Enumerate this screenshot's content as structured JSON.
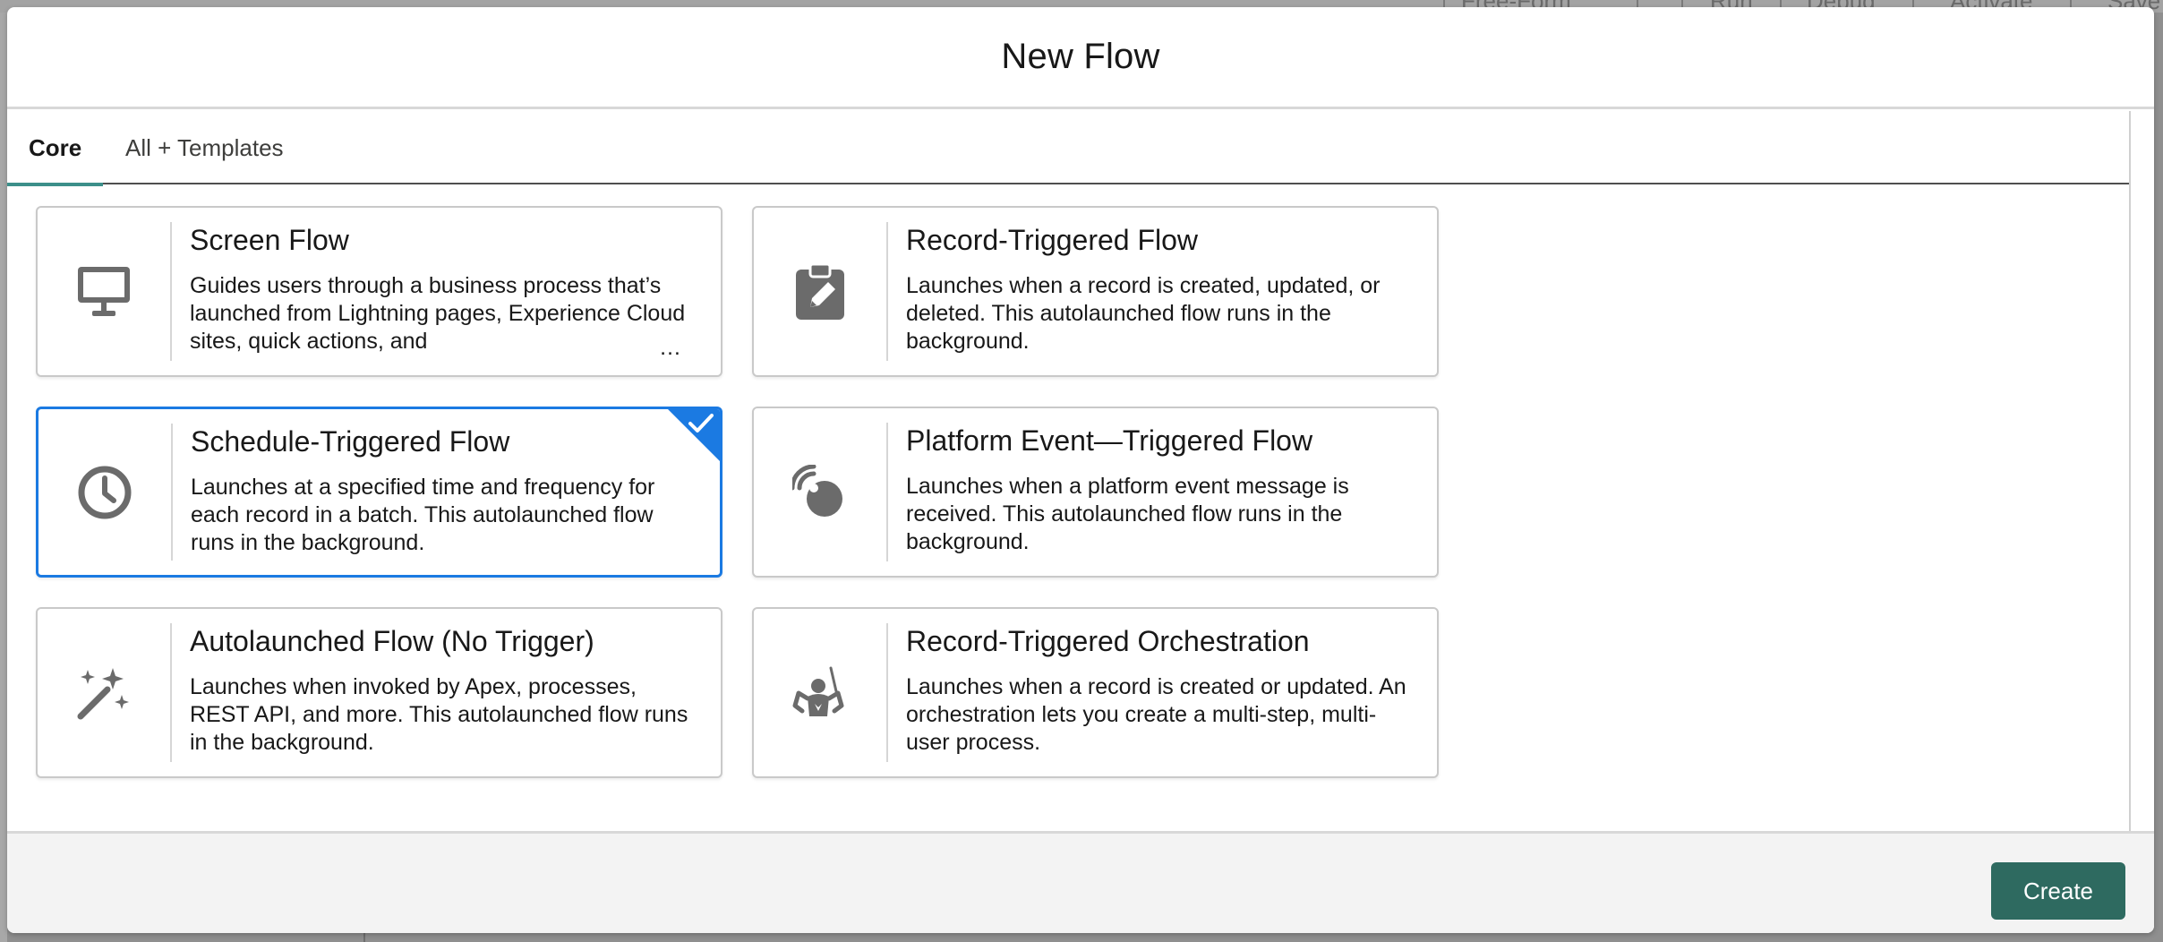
{
  "background": {
    "toolbar_items": [
      "Free-Form",
      "Run",
      "Debug",
      "Activate",
      "Save"
    ]
  },
  "modal": {
    "title": "New Flow",
    "tabs": [
      {
        "label": "Core",
        "active": true
      },
      {
        "label": "All + Templates",
        "active": false
      }
    ],
    "cards": [
      {
        "title": "Screen Flow",
        "description": "Guides users through a business process that’s launched from Lightning pages, Experience Cloud sites, quick actions, and",
        "icon": "desktop-icon",
        "selected": false,
        "truncated": true,
        "ellipsis": "…"
      },
      {
        "title": "Record-Triggered Flow",
        "description": "Launches when a record is created, updated, or deleted. This autolaunched flow runs in the background.",
        "icon": "clipboard-edit-icon",
        "selected": false
      },
      {
        "title": "Schedule-Triggered Flow",
        "description": "Launches at a specified time and frequency for each record in a batch. This autolaunched flow runs in the background.",
        "icon": "clock-icon",
        "selected": true
      },
      {
        "title": "Platform Event—Triggered Flow",
        "description": "Launches when a platform event message is received. This autolaunched flow runs in the background.",
        "icon": "broadcast-icon",
        "selected": false
      },
      {
        "title": "Autolaunched Flow (No Trigger)",
        "description": "Launches when invoked by Apex, processes, REST API, and more. This autolaunched flow runs in the background.",
        "icon": "magic-wand-icon",
        "selected": false
      },
      {
        "title": "Record-Triggered Orchestration",
        "description": "Launches when a record is created or updated. An orchestration lets you create a multi-step, multi-user process.",
        "icon": "conductor-icon",
        "selected": false
      }
    ],
    "footer": {
      "create_label": "Create"
    }
  },
  "colors": {
    "selected_border": "#1b7ae2",
    "active_tab_underline": "#3c8f8a",
    "create_button": "#2e6a60",
    "icon_gray": "#6b6b6b"
  }
}
